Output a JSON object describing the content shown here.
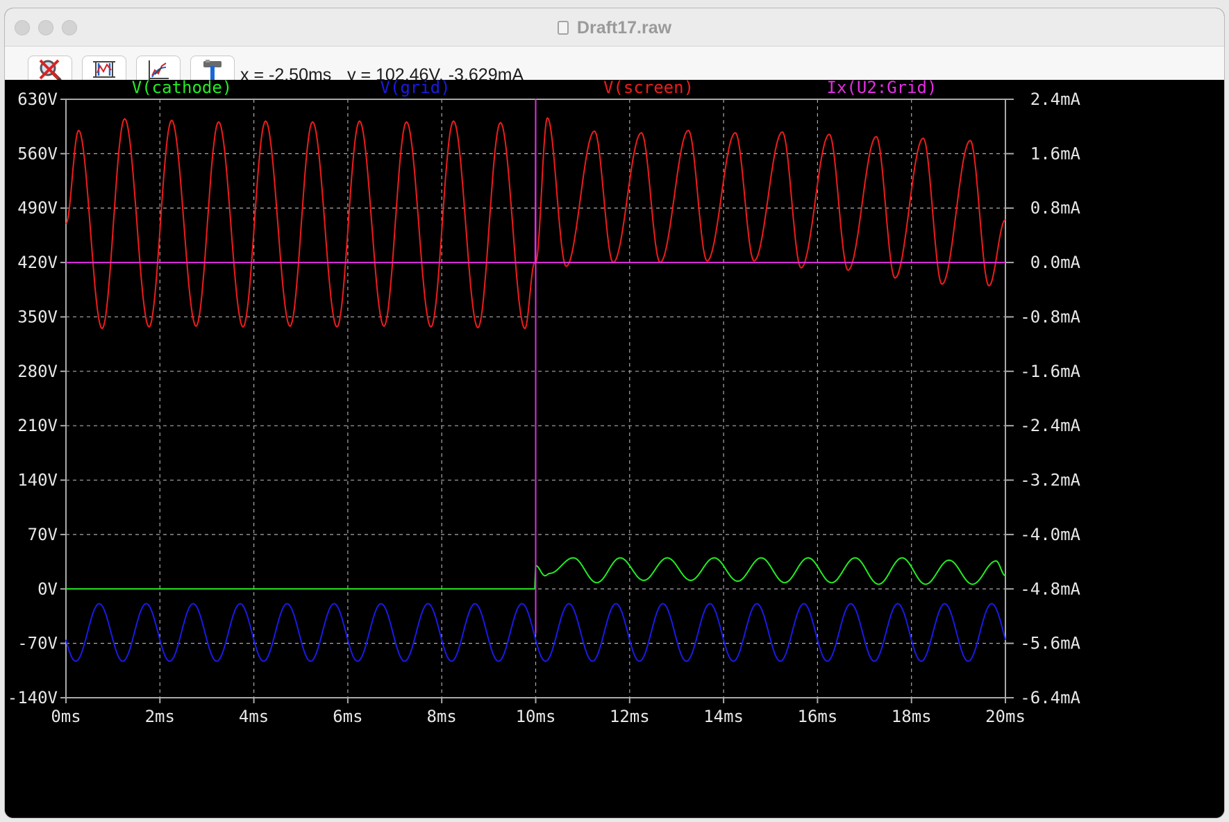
{
  "window": {
    "title": "Draft17.raw"
  },
  "toolbar": {
    "buttons": [
      {
        "name": "zoom-cancel-icon"
      },
      {
        "name": "autorange-icon"
      },
      {
        "name": "zoom-fit-icon"
      },
      {
        "name": "tools-hammer-icon"
      }
    ],
    "cursor_x": "x = -2.50ms",
    "cursor_y": "y = 102.46V, -3.629mA"
  },
  "colors": {
    "background": "#000000",
    "grid": "#aaaaaa",
    "cathode": "#22ee22",
    "grid_trace": "#1a1ae6",
    "screen": "#ee1c1c",
    "ix": "#e22ee2",
    "axis_text": "#e8e8e8"
  },
  "chart_data": {
    "type": "line",
    "title": "",
    "x_tick_labels": [
      "0ms",
      "2ms",
      "4ms",
      "6ms",
      "8ms",
      "10ms",
      "12ms",
      "14ms",
      "16ms",
      "18ms",
      "20ms"
    ],
    "y_left_tick_labels": [
      "630V",
      "560V",
      "490V",
      "420V",
      "350V",
      "280V",
      "210V",
      "140V",
      "70V",
      "0V",
      "-70V",
      "-140V"
    ],
    "y_right_tick_labels": [
      "2.4mA",
      "1.6mA",
      "0.8mA",
      "0.0mA",
      "-0.8mA",
      "-1.6mA",
      "-2.4mA",
      "-3.2mA",
      "-4.0mA",
      "-4.8mA",
      "-5.6mA",
      "-6.4mA"
    ],
    "xlim_ms": [
      0,
      20
    ],
    "ylim_left_V": [
      -140,
      630
    ],
    "ylim_right_mA": [
      -6.4,
      2.4
    ],
    "grid": true,
    "series": [
      {
        "name": "V(cathode)",
        "axis": "left",
        "color": "#22ee22",
        "t": [
          0,
          2,
          4,
          6,
          8,
          9.98,
          10,
          10.2,
          10.3,
          10.8,
          11.3,
          11.8,
          12.3,
          12.8,
          13.3,
          13.8,
          14.3,
          14.8,
          15.3,
          15.8,
          16.3,
          16.8,
          17.3,
          17.8,
          18.3,
          18.8,
          19.3,
          19.8,
          20
        ],
        "v": [
          0,
          0,
          0,
          0,
          0,
          0,
          30,
          17,
          20,
          40,
          8,
          40,
          11,
          40,
          11,
          40,
          10,
          40,
          8,
          40,
          8,
          40,
          6,
          40,
          6,
          37,
          6,
          36,
          17
        ]
      },
      {
        "name": "V(grid)",
        "axis": "left",
        "color": "#1a1ae6",
        "sine": {
          "offset": -56,
          "amplitude": 37,
          "frequency_hz": 1000,
          "phase_deg": 195
        }
      },
      {
        "name": "V(screen)",
        "axis": "left",
        "color": "#ee1c1c",
        "t": [
          0,
          0.27,
          0.77,
          1.25,
          1.77,
          2.25,
          2.77,
          3.25,
          3.77,
          4.25,
          4.77,
          5.25,
          5.77,
          6.25,
          6.77,
          7.25,
          7.77,
          8.25,
          8.77,
          9.25,
          9.77,
          9.98,
          10.0,
          10.25,
          10.65,
          11.25,
          11.65,
          12.25,
          12.65,
          13.25,
          13.65,
          14.25,
          14.65,
          15.25,
          15.65,
          16.25,
          16.65,
          17.25,
          17.65,
          18.25,
          18.65,
          19.25,
          19.65,
          20
        ],
        "v": [
          470,
          590,
          335,
          605,
          337,
          603,
          338,
          601,
          337,
          602,
          338,
          601,
          337,
          602,
          338,
          601,
          337,
          602,
          336,
          600,
          335,
          420,
          420,
          606,
          415,
          589,
          420,
          587,
          420,
          590,
          422,
          587,
          422,
          588,
          413,
          585,
          410,
          582,
          400,
          580,
          392,
          577,
          390,
          475
        ]
      },
      {
        "name": "Ix(U2:Grid)",
        "axis": "right",
        "color": "#e22ee2",
        "t": [
          0,
          9.99,
          10.0,
          10.0,
          10.0,
          20
        ],
        "v": [
          0,
          0,
          2.4,
          -5.45,
          0,
          0
        ]
      }
    ]
  }
}
